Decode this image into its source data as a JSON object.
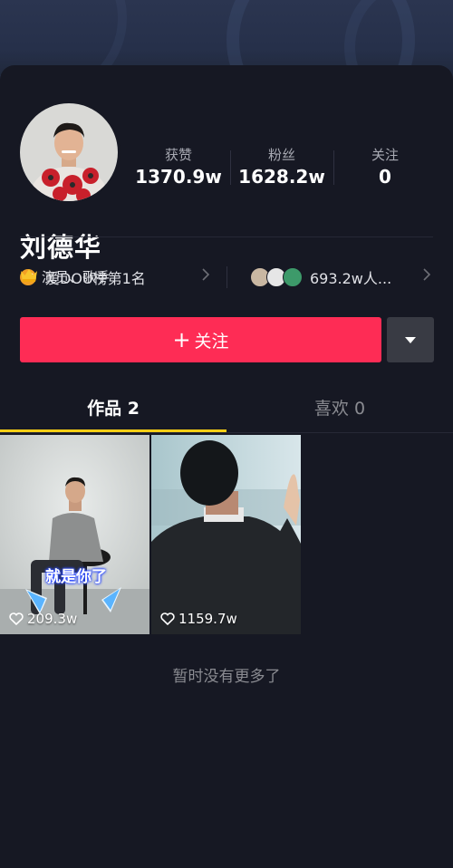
{
  "profile": {
    "name": "刘德华",
    "role": "演员、歌手"
  },
  "stats": [
    {
      "label": "获赞",
      "value": "1370.9w"
    },
    {
      "label": "粉丝",
      "value": "1628.2w"
    },
    {
      "label": "关注",
      "value": "0"
    }
  ],
  "rank": {
    "text": "爱DOU榜第1名"
  },
  "fans": {
    "text": "693.2w人..."
  },
  "actions": {
    "follow_label": "关注"
  },
  "tabs": [
    {
      "label": "作品 2"
    },
    {
      "label": "喜欢 0"
    }
  ],
  "videos": [
    {
      "likes": "209.3w",
      "caption": "就是你了"
    },
    {
      "likes": "1159.7w"
    }
  ],
  "footer": {
    "end_text": "暂时没有更多了"
  },
  "colors": {
    "accent": "#fe2c55",
    "tab_indicator": "#face15",
    "verified": "#f2a024"
  }
}
